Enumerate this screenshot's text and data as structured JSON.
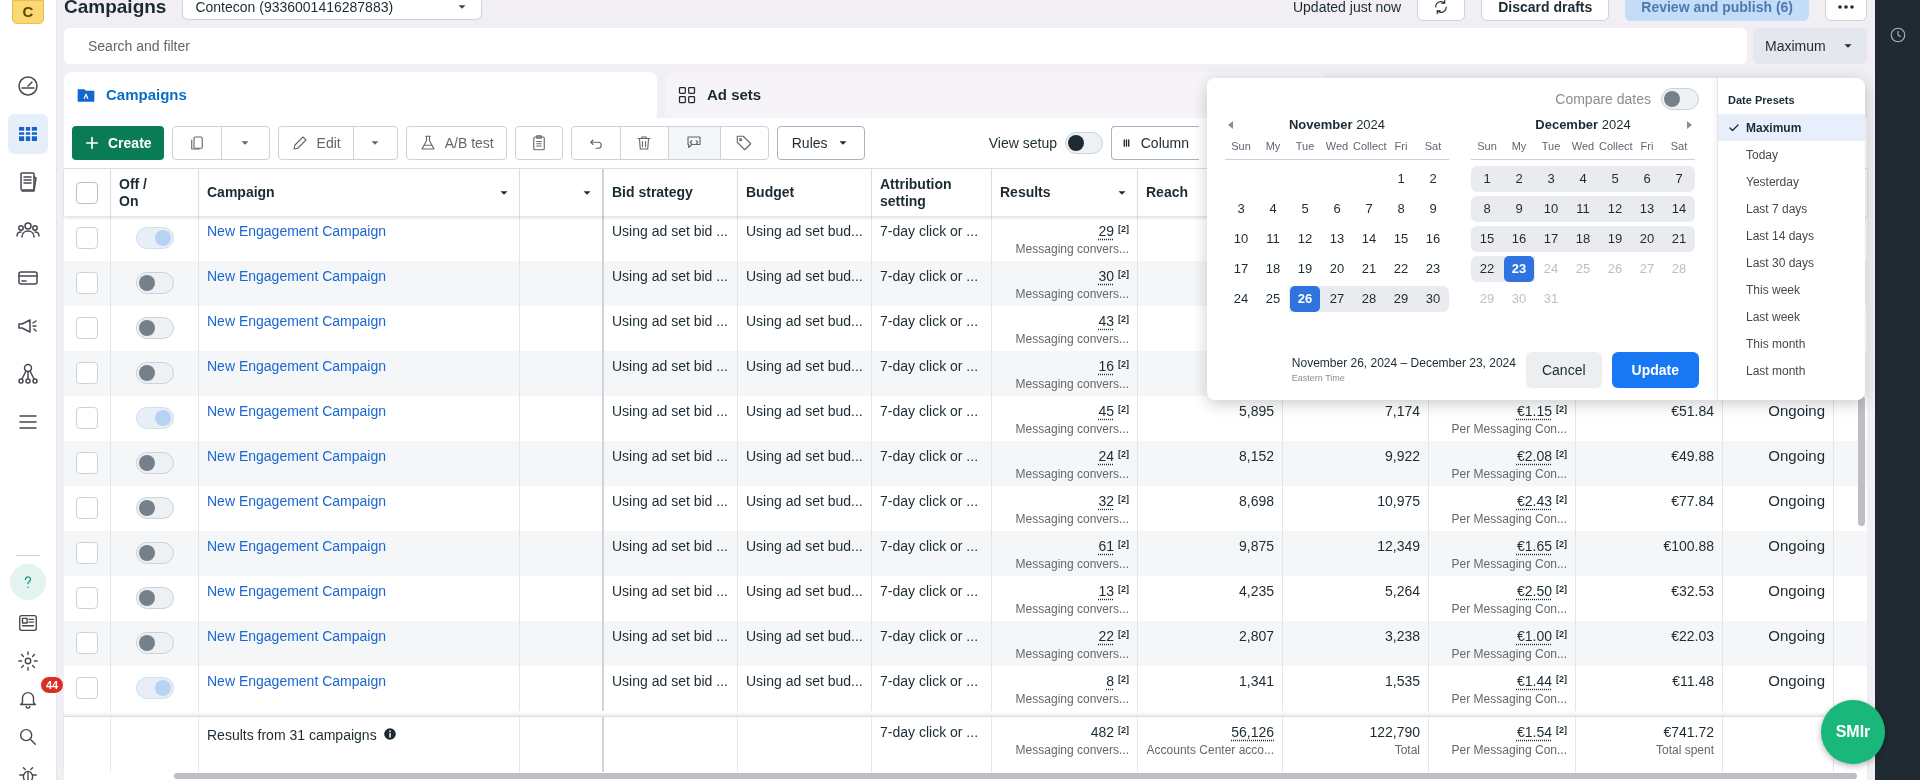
{
  "sidebar": {
    "logo": "C",
    "nav": [
      {
        "selected": false
      },
      {
        "selected": true
      },
      {
        "selected": false
      },
      {
        "selected": false
      },
      {
        "selected": false
      },
      {
        "selected": false
      },
      {
        "selected": false
      },
      {
        "selected": false
      }
    ],
    "notification_badge": "44"
  },
  "header": {
    "title": "Campaigns",
    "account": "Contecon (9336001416287883)",
    "updated": "Updated just now",
    "discard": "Discard drafts",
    "publish": {
      "label": "Review and publish (6)",
      "disabled": true
    }
  },
  "search": {
    "placeholder": "Search and filter"
  },
  "date_button": "Maximum",
  "tabs": [
    {
      "label": "Campaigns",
      "selected": true
    },
    {
      "label": "Ad sets",
      "selected": false
    }
  ],
  "toolbar": {
    "create": "Create",
    "edit": "Edit",
    "ab_test": "A/B test",
    "rules": "Rules",
    "view_setup": {
      "label": "View setup",
      "on": false
    },
    "columns": "Column"
  },
  "table": {
    "header_checked": false,
    "columns": [
      "Off /\nOn",
      "Campaign",
      "",
      "Bid strategy",
      "Budget",
      "Attribution setting",
      "Results",
      "Reach"
    ],
    "rows": [
      {
        "checked": false,
        "on": true,
        "name": "New Engagement Campaign",
        "bid": "Using ad set bid ...",
        "budget": "Using ad set bud...",
        "attribution": "7-day click or ...",
        "results": "29",
        "results_note": "[2]",
        "results_label": "Messaging convers..."
      },
      {
        "checked": false,
        "on": false,
        "name": "New Engagement Campaign",
        "bid": "Using ad set bid ...",
        "budget": "Using ad set bud...",
        "attribution": "7-day click or ...",
        "results": "30",
        "results_note": "[2]",
        "results_label": "Messaging convers..."
      },
      {
        "checked": false,
        "on": false,
        "name": "New Engagement Campaign",
        "bid": "Using ad set bid ...",
        "budget": "Using ad set bud...",
        "attribution": "7-day click or ...",
        "results": "43",
        "results_note": "[2]",
        "results_label": "Messaging convers..."
      },
      {
        "checked": false,
        "on": false,
        "name": "New Engagement Campaign",
        "bid": "Using ad set bid ...",
        "budget": "Using ad set bud...",
        "attribution": "7-day click or ...",
        "results": "16",
        "results_note": "[2]",
        "results_label": "Messaging convers..."
      },
      {
        "checked": false,
        "on": true,
        "name": "New Engagement Campaign",
        "bid": "Using ad set bid ...",
        "budget": "Using ad set bud...",
        "attribution": "7-day click or ...",
        "results": "45",
        "results_note": "[2]",
        "results_label": "Messaging convers...",
        "reach": "5,895",
        "impressions": "7,174",
        "cost": "€1.15",
        "cost_note": "[2]",
        "cost_label": "Per Messaging Con...",
        "spent": "€51.84",
        "status": "Ongoing"
      },
      {
        "checked": false,
        "on": false,
        "name": "New Engagement Campaign",
        "bid": "Using ad set bid ...",
        "budget": "Using ad set bud...",
        "attribution": "7-day click or ...",
        "results": "24",
        "results_note": "[2]",
        "results_label": "Messaging convers...",
        "reach": "8,152",
        "impressions": "9,922",
        "cost": "€2.08",
        "cost_note": "[2]",
        "cost_label": "Per Messaging Con...",
        "spent": "€49.88",
        "status": "Ongoing"
      },
      {
        "checked": false,
        "on": false,
        "name": "New Engagement Campaign",
        "bid": "Using ad set bid ...",
        "budget": "Using ad set bud...",
        "attribution": "7-day click or ...",
        "results": "32",
        "results_note": "[2]",
        "results_label": "Messaging convers...",
        "reach": "8,698",
        "impressions": "10,975",
        "cost": "€2.43",
        "cost_note": "[2]",
        "cost_label": "Per Messaging Con...",
        "spent": "€77.84",
        "status": "Ongoing"
      },
      {
        "checked": false,
        "on": false,
        "name": "New Engagement Campaign",
        "bid": "Using ad set bid ...",
        "budget": "Using ad set bud...",
        "attribution": "7-day click or ...",
        "results": "61",
        "results_note": "[2]",
        "results_label": "Messaging convers...",
        "reach": "9,875",
        "impressions": "12,349",
        "cost": "€1.65",
        "cost_note": "[2]",
        "cost_label": "Per Messaging Con...",
        "spent": "€100.88",
        "status": "Ongoing"
      },
      {
        "checked": false,
        "on": false,
        "name": "New Engagement Campaign",
        "bid": "Using ad set bid ...",
        "budget": "Using ad set bud...",
        "attribution": "7-day click or ...",
        "results": "13",
        "results_note": "[2]",
        "results_label": "Messaging convers...",
        "reach": "4,235",
        "impressions": "5,264",
        "cost": "€2.50",
        "cost_note": "[2]",
        "cost_label": "Per Messaging Con...",
        "spent": "€32.53",
        "status": "Ongoing"
      },
      {
        "checked": false,
        "on": false,
        "name": "New Engagement Campaign",
        "bid": "Using ad set bid ...",
        "budget": "Using ad set bud...",
        "attribution": "7-day click or ...",
        "results": "22",
        "results_note": "[2]",
        "results_label": "Messaging convers...",
        "reach": "2,807",
        "impressions": "3,238",
        "cost": "€1.00",
        "cost_note": "[2]",
        "cost_label": "Per Messaging Con...",
        "spent": "€22.03",
        "status": "Ongoing"
      },
      {
        "checked": false,
        "on": true,
        "name": "New Engagement Campaign",
        "bid": "Using ad set bid ...",
        "budget": "Using ad set bud...",
        "attribution": "7-day click or ...",
        "results": "8",
        "results_note": "[2]",
        "results_label": "Messaging convers...",
        "reach": "1,341",
        "impressions": "1,535",
        "cost": "€1.44",
        "cost_note": "[2]",
        "cost_label": "Per Messaging Con...",
        "spent": "€11.48",
        "status": "Ongoing"
      }
    ],
    "footer": {
      "summary": "Results from 31 campaigns",
      "attribution": "7-day click or ...",
      "results": {
        "value": "482",
        "note": "[2]",
        "label": "Messaging convers..."
      },
      "reach": {
        "value": "56,126",
        "label": "Accounts Center acco..."
      },
      "impressions": {
        "value": "122,790",
        "label": "Total"
      },
      "cost": {
        "value": "€1.54",
        "note": "[2]",
        "label": "Per Messaging Con..."
      },
      "spent": {
        "value": "€741.72",
        "label": "Total spent"
      }
    }
  },
  "date_picker": {
    "compare": {
      "label": "Compare dates",
      "on": false
    },
    "months": [
      {
        "month": "November",
        "year": "2024",
        "weekdays": [
          "Sun",
          "My",
          "Tue",
          "Wed",
          "Collect",
          "Fri",
          "Sat"
        ],
        "weeks": [
          [
            {
              "label": "1",
              "in_range": false,
              "selected": false,
              "disabled": false
            },
            {
              "label": "2",
              "in_range": false,
              "selected": false,
              "disabled": false
            }
          ],
          [
            {
              "label": "3",
              "in_range": false,
              "selected": false,
              "disabled": false
            },
            {
              "label": "4",
              "in_range": false,
              "selected": false,
              "disabled": false
            },
            {
              "label": "5",
              "in_range": false,
              "selected": false,
              "disabled": false
            },
            {
              "label": "6",
              "in_range": false,
              "selected": false,
              "disabled": false
            },
            {
              "label": "7",
              "in_range": false,
              "selected": false,
              "disabled": false
            },
            {
              "label": "8",
              "in_range": false,
              "selected": false,
              "disabled": false
            },
            {
              "label": "9",
              "in_range": false,
              "selected": false,
              "disabled": false
            }
          ],
          [
            {
              "label": "10",
              "in_range": false,
              "selected": false,
              "disabled": false
            },
            {
              "label": "11",
              "in_range": false,
              "selected": false,
              "disabled": false
            },
            {
              "label": "12",
              "in_range": false,
              "selected": false,
              "disabled": false
            },
            {
              "label": "13",
              "in_range": false,
              "selected": false,
              "disabled": false
            },
            {
              "label": "14",
              "in_range": false,
              "selected": false,
              "disabled": false
            },
            {
              "label": "15",
              "in_range": false,
              "selected": false,
              "disabled": false
            },
            {
              "label": "16",
              "in_range": false,
              "selected": false,
              "disabled": false
            }
          ],
          [
            {
              "label": "17",
              "in_range": false,
              "selected": false,
              "disabled": false
            },
            {
              "label": "18",
              "in_range": false,
              "selected": false,
              "disabled": false
            },
            {
              "label": "19",
              "in_range": false,
              "selected": false,
              "disabled": false
            },
            {
              "label": "20",
              "in_range": false,
              "selected": false,
              "disabled": false
            },
            {
              "label": "21",
              "in_range": false,
              "selected": false,
              "disabled": false
            },
            {
              "label": "22",
              "in_range": false,
              "selected": false,
              "disabled": false
            },
            {
              "label": "23",
              "in_range": false,
              "selected": false,
              "disabled": false
            }
          ],
          [
            {
              "label": "24",
              "in_range": false,
              "selected": false,
              "disabled": false
            },
            {
              "label": "25",
              "in_range": false,
              "selected": false,
              "disabled": false
            },
            {
              "label": "26",
              "in_range": true,
              "selected": true,
              "disabled": false
            },
            {
              "label": "27",
              "in_range": true,
              "selected": false,
              "disabled": false
            },
            {
              "label": "28",
              "in_range": true,
              "selected": false,
              "disabled": false
            },
            {
              "label": "29",
              "in_range": true,
              "selected": false,
              "disabled": false
            },
            {
              "label": "30",
              "in_range": true,
              "selected": false,
              "disabled": false
            }
          ]
        ]
      },
      {
        "month": "December",
        "year": "2024",
        "weekdays": [
          "Sun",
          "My",
          "Tue",
          "Wed",
          "Collect",
          "Fri",
          "Sat"
        ],
        "weeks": [
          [
            {
              "label": "1",
              "in_range": true,
              "selected": false,
              "disabled": false
            },
            {
              "label": "2",
              "in_range": true,
              "selected": false,
              "disabled": false
            },
            {
              "label": "3",
              "in_range": true,
              "selected": false,
              "disabled": false
            },
            {
              "label": "4",
              "in_range": true,
              "selected": false,
              "disabled": false
            },
            {
              "label": "5",
              "in_range": true,
              "selected": false,
              "disabled": false
            },
            {
              "label": "6",
              "in_range": true,
              "selected": false,
              "disabled": false
            },
            {
              "label": "7",
              "in_range": true,
              "selected": false,
              "disabled": false
            }
          ],
          [
            {
              "label": "8",
              "in_range": true,
              "selected": false,
              "disabled": false
            },
            {
              "label": "9",
              "in_range": true,
              "selected": false,
              "disabled": false
            },
            {
              "label": "10",
              "in_range": true,
              "selected": false,
              "disabled": false
            },
            {
              "label": "11",
              "in_range": true,
              "selected": false,
              "disabled": false
            },
            {
              "label": "12",
              "in_range": true,
              "selected": false,
              "disabled": false
            },
            {
              "label": "13",
              "in_range": true,
              "selected": false,
              "disabled": false
            },
            {
              "label": "14",
              "in_range": true,
              "selected": false,
              "disabled": false
            }
          ],
          [
            {
              "label": "15",
              "in_range": true,
              "selected": false,
              "disabled": false
            },
            {
              "label": "16",
              "in_range": true,
              "selected": false,
              "disabled": false
            },
            {
              "label": "17",
              "in_range": true,
              "selected": false,
              "disabled": false
            },
            {
              "label": "18",
              "in_range": true,
              "selected": false,
              "disabled": false
            },
            {
              "label": "19",
              "in_range": true,
              "selected": false,
              "disabled": false
            },
            {
              "label": "20",
              "in_range": true,
              "selected": false,
              "disabled": false
            },
            {
              "label": "21",
              "in_range": true,
              "selected": false,
              "disabled": false
            }
          ],
          [
            {
              "label": "22",
              "in_range": true,
              "selected": false,
              "disabled": false
            },
            {
              "label": "23",
              "in_range": true,
              "selected": true,
              "disabled": false
            },
            {
              "label": "24",
              "in_range": false,
              "selected": false,
              "disabled": true
            },
            {
              "label": "25",
              "in_range": false,
              "selected": false,
              "disabled": true
            },
            {
              "label": "26",
              "in_range": false,
              "selected": false,
              "disabled": true
            },
            {
              "label": "27",
              "in_range": false,
              "selected": false,
              "disabled": true
            },
            {
              "label": "28",
              "in_range": false,
              "selected": false,
              "disabled": true
            }
          ],
          [
            {
              "label": "29",
              "in_range": false,
              "selected": false,
              "disabled": true
            },
            {
              "label": "30",
              "in_range": false,
              "selected": false,
              "disabled": true
            },
            {
              "label": "31",
              "in_range": false,
              "selected": false,
              "disabled": true
            }
          ]
        ]
      }
    ],
    "range": "November 26, 2024 – December 23, 2024",
    "timezone": "Eastern Time",
    "cancel": "Cancel",
    "update": "Update",
    "presets_title": "Date Presets",
    "presets": [
      {
        "label": "Maximum",
        "selected": true
      },
      {
        "label": "Today",
        "selected": false
      },
      {
        "label": "Yesterday",
        "selected": false
      },
      {
        "label": "Last 7 days",
        "selected": false
      },
      {
        "label": "Last 14 days",
        "selected": false
      },
      {
        "label": "Last 30 days",
        "selected": false
      },
      {
        "label": "This week",
        "selected": false
      },
      {
        "label": "Last week",
        "selected": false
      },
      {
        "label": "This month",
        "selected": false
      },
      {
        "label": "Last month",
        "selected": false
      }
    ]
  },
  "assistant_button": "SMIr"
}
